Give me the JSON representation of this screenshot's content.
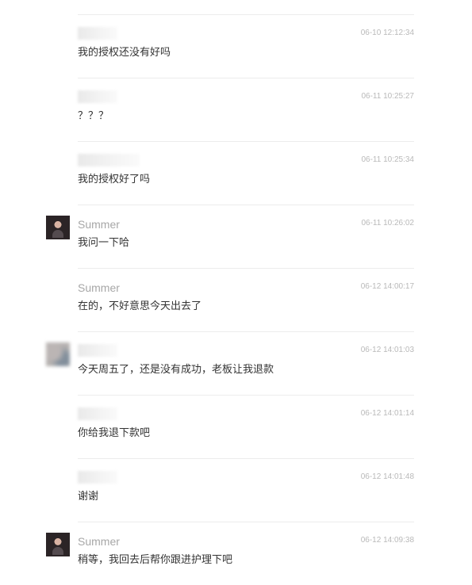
{
  "messages": [
    {
      "sender": "",
      "time": "06-10 12:12:34",
      "text": "我的授权还没有好吗"
    },
    {
      "sender": "",
      "time": "06-11 10:25:27",
      "text": "？？？"
    },
    {
      "sender": "",
      "time": "06-11 10:25:34",
      "text": "我的授权好了吗"
    },
    {
      "sender": "Summer",
      "time": "06-11 10:26:02",
      "text": "我问一下哈"
    },
    {
      "sender": "Summer",
      "time": "06-12 14:00:17",
      "text": "在的，不好意思今天出去了"
    },
    {
      "sender": "",
      "time": "06-12 14:01:03",
      "text": "今天周五了，还是没有成功，老板让我退款"
    },
    {
      "sender": "",
      "time": "06-12 14:01:14",
      "text": "你给我退下款吧"
    },
    {
      "sender": "",
      "time": "06-12 14:01:48",
      "text": "谢谢"
    },
    {
      "sender": "Summer",
      "time": "06-12 14:09:38",
      "text": "稍等，我回去后帮你跟进护理下吧"
    }
  ]
}
